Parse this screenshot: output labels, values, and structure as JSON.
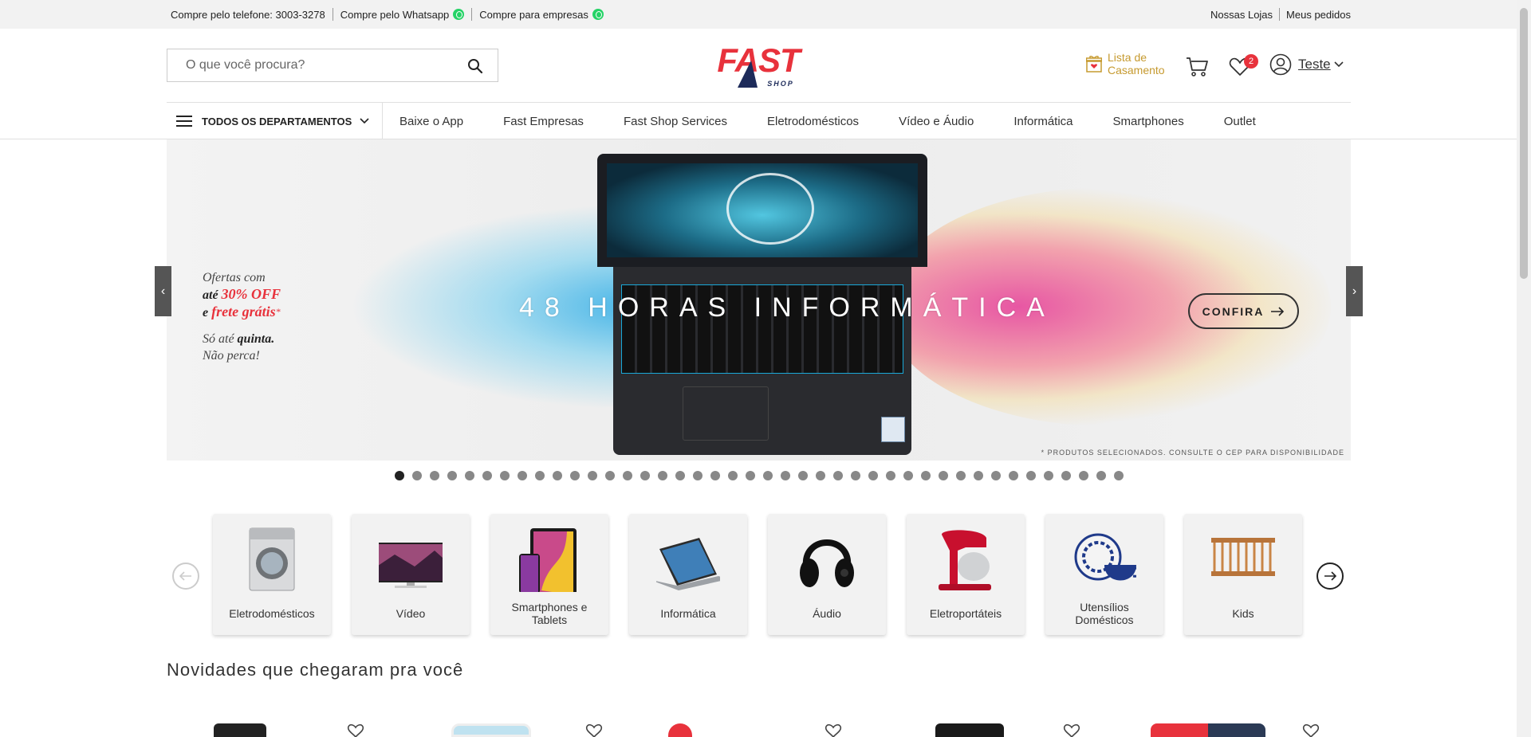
{
  "topbar": {
    "phone": "Compre pelo telefone: 3003-3278",
    "whatsapp": "Compre pelo Whatsapp",
    "business": "Compre para empresas",
    "stores": "Nossas Lojas",
    "orders": "Meus pedidos"
  },
  "header": {
    "search_placeholder": "O que você procura?",
    "logo_main": "FAST",
    "logo_sub": "SHOP",
    "wedding_line1": "Lista de",
    "wedding_line2": "Casamento",
    "wishlist_count": "2",
    "user_name": "Teste"
  },
  "nav": {
    "departments": "TODOS OS DEPARTAMENTOS",
    "links": [
      "Baixe o App",
      "Fast Empresas",
      "Fast Shop Services",
      "Eletrodomésticos",
      "Vídeo e Áudio",
      "Informática",
      "Smartphones",
      "Outlet"
    ]
  },
  "banner": {
    "offer_line1": "Ofertas com",
    "offer_line2a": "até ",
    "offer_line2b": "30% OFF",
    "offer_line3a": "e ",
    "offer_line3b": "frete grátis",
    "offer_line3c": "*",
    "offer_line4a": "Só até ",
    "offer_line4b": "quinta.",
    "offer_line5": "Não perca!",
    "title": "48 HORAS INFORMÁTICA",
    "cta": "CONFIRA",
    "disclaimer": "* PRODUTOS SELECIONADOS. CONSULTE O CEP PARA DISPONIBILIDADE",
    "prev_symbol": "‹",
    "next_symbol": "›",
    "slide_count": 42,
    "active_slide": 1
  },
  "categories": [
    {
      "label": "Eletrodomésticos",
      "icon": "washing-machine"
    },
    {
      "label": "Vídeo",
      "icon": "tv"
    },
    {
      "label": "Smartphones e Tablets",
      "icon": "phone-tablet"
    },
    {
      "label": "Informática",
      "icon": "laptop"
    },
    {
      "label": "Áudio",
      "icon": "headphones"
    },
    {
      "label": "Eletroportáteis",
      "icon": "stand-mixer"
    },
    {
      "label": "Utensílios Domésticos",
      "icon": "plate-cup"
    },
    {
      "label": "Kids",
      "icon": "crib"
    }
  ],
  "section": {
    "title": "Novidades que chegaram pra você"
  },
  "colors": {
    "brand_red": "#e8323c",
    "brand_navy": "#1d2b5a",
    "wedding_gold": "#c69a2f",
    "whatsapp_green": "#25d366"
  }
}
